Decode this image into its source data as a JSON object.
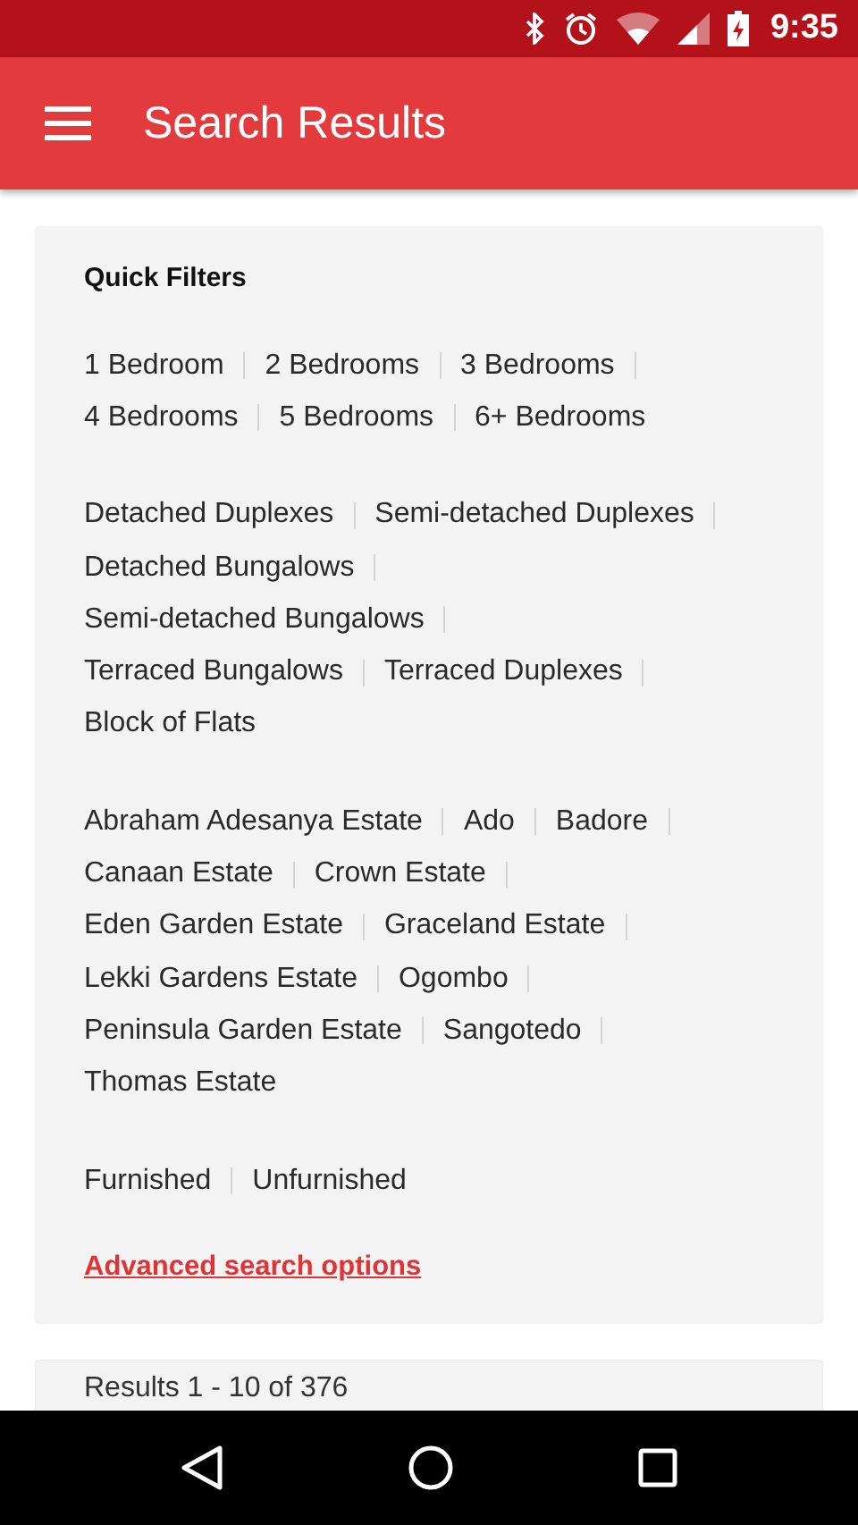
{
  "status_bar": {
    "time": "9:35"
  },
  "app_bar": {
    "title": "Search Results"
  },
  "quick_filters": {
    "title": "Quick Filters",
    "groups": [
      {
        "lines": [
          [
            "1 Bedroom",
            "2 Bedrooms",
            "3 Bedrooms"
          ],
          [
            "4 Bedrooms",
            "5 Bedrooms",
            "6+ Bedrooms"
          ]
        ]
      },
      {
        "lines": [
          [
            "Detached Duplexes",
            "Semi-detached Duplexes"
          ],
          [
            "Detached Bungalows"
          ],
          [
            "Semi-detached Bungalows"
          ],
          [
            "Terraced Bungalows",
            "Terraced Duplexes"
          ],
          [
            "Block of Flats"
          ]
        ]
      },
      {
        "lines": [
          [
            "Abraham Adesanya Estate",
            "Ado",
            "Badore"
          ],
          [
            "Canaan Estate",
            "Crown Estate"
          ],
          [
            "Eden Garden Estate",
            "Graceland Estate"
          ],
          [
            "Lekki Gardens Estate",
            "Ogombo"
          ],
          [
            "Peninsula Garden Estate",
            "Sangotedo"
          ],
          [
            "Thomas Estate"
          ]
        ]
      },
      {
        "lines": [
          [
            "Furnished",
            "Unfurnished"
          ]
        ]
      }
    ],
    "advanced_link": "Advanced search options"
  },
  "results": {
    "summary": "Results 1 - 10 of 376"
  }
}
